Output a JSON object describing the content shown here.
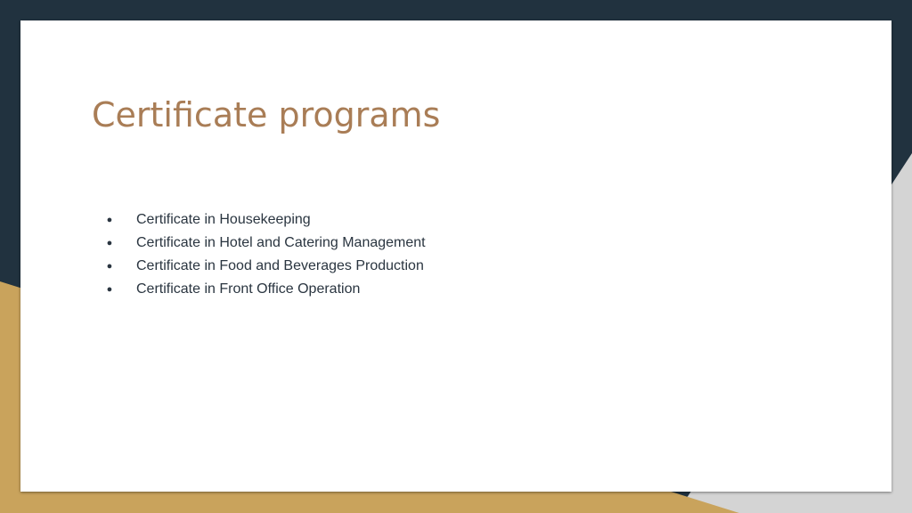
{
  "slide": {
    "title": "Certificate programs",
    "bullets": [
      "Certificate in Housekeeping",
      "Certificate in Hotel and Catering Management",
      "Certificate in Food and Beverages Production",
      "Certificate in Front Office Operation"
    ],
    "bullet_glyph": "●"
  },
  "colors": {
    "background_dark": "#21323f",
    "accent_gold": "#c9a35c",
    "accent_grey": "#d4d4d4",
    "title": "#a97d56",
    "body_text": "#2a3540",
    "card": "#ffffff"
  }
}
